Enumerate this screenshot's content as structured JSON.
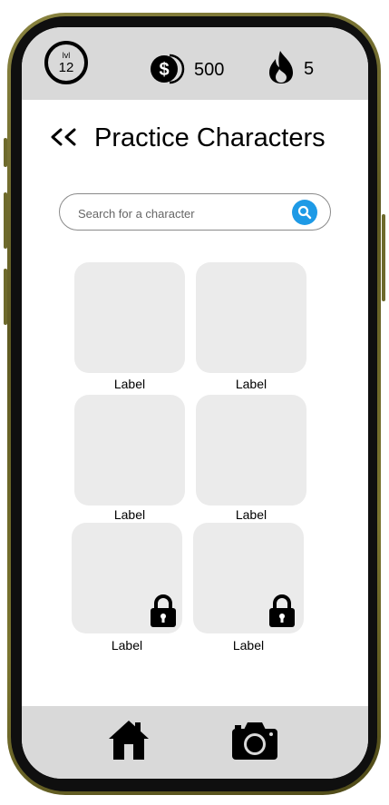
{
  "status": {
    "level_prefix": "lvl",
    "level_number": "12",
    "coins": "500",
    "streak": "5"
  },
  "header": {
    "back_icon": "double-chevron-left-icon",
    "title": "Practice Characters"
  },
  "search": {
    "placeholder": "Search for a character",
    "value": "",
    "icon": "search-icon"
  },
  "grid": {
    "cards": [
      {
        "label": "Label",
        "locked": false
      },
      {
        "label": "Label",
        "locked": false
      },
      {
        "label": "Label",
        "locked": false
      },
      {
        "label": "Label",
        "locked": false
      },
      {
        "label": "Label",
        "locked": true
      },
      {
        "label": "Label",
        "locked": true
      }
    ]
  },
  "bottom_nav": {
    "items": [
      {
        "icon": "home-icon"
      },
      {
        "icon": "camera-icon"
      }
    ]
  },
  "colors": {
    "bar_background": "#d9d9d9",
    "card_background": "#ebebeb",
    "search_accent": "#1e9ae6",
    "frame": "#6e6a2c"
  }
}
